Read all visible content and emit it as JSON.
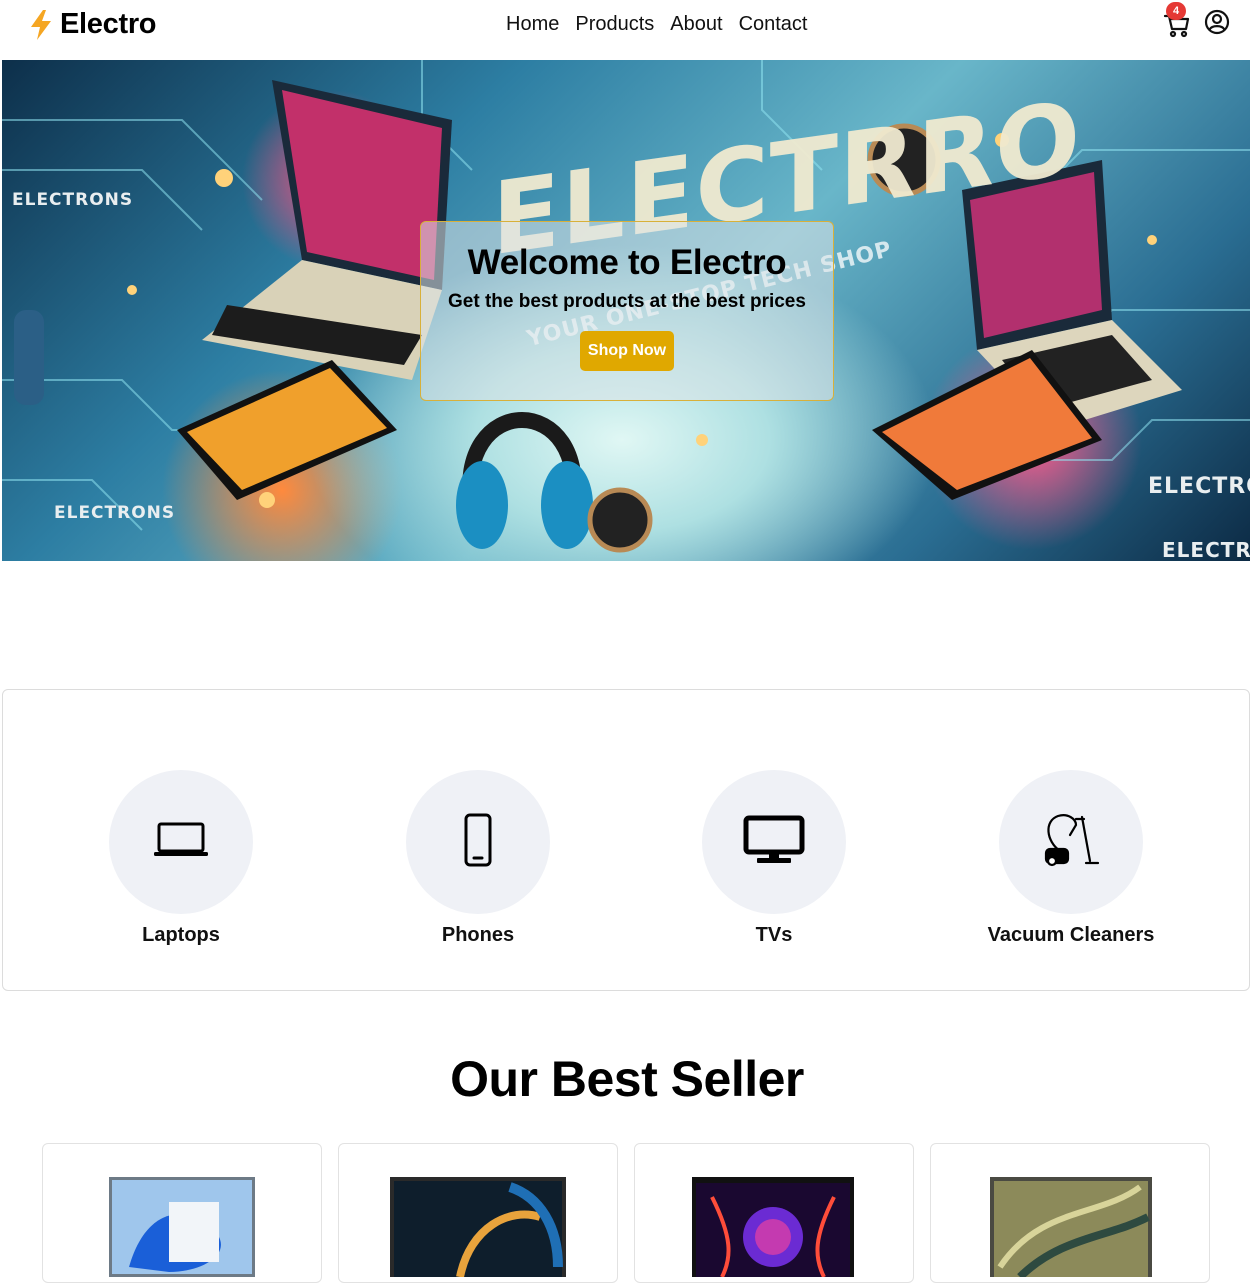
{
  "navbar": {
    "brand": "Electro",
    "brand_icon": "lightning-bolt-icon",
    "links": [
      "Home",
      "Products",
      "About",
      "Contact"
    ],
    "cart_count": "4",
    "cart_icon": "cart-icon",
    "user_icon": "user-circle-icon",
    "accent": "#f5a623"
  },
  "hero": {
    "title": "Welcome to Electro",
    "subtitle": "Get the best products at the best prices",
    "cta": "Shop Now",
    "cta_color": "#e0a800",
    "image_words": [
      "ELECTRONS",
      "ELECTRONS",
      "ELECTRO",
      "ELECTRO",
      "ELECTRRO",
      "YOUR ONE-STOP TECH SHOP"
    ]
  },
  "categories": [
    {
      "label": "Laptops",
      "icon": "laptop-icon"
    },
    {
      "label": "Phones",
      "icon": "phone-icon"
    },
    {
      "label": "TVs",
      "icon": "tv-icon"
    },
    {
      "label": "Vacuum Cleaners",
      "icon": "vacuum-icon"
    }
  ],
  "best_seller": {
    "title": "Our Best Seller",
    "products": [
      {
        "image": "laptop-windows-image"
      },
      {
        "image": "laptop-dark-image"
      },
      {
        "image": "gaming-laptop-image"
      },
      {
        "image": "laptop-gold-image"
      }
    ]
  }
}
